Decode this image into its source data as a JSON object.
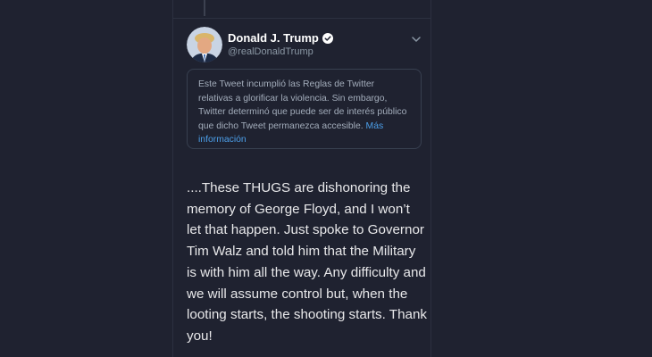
{
  "tweet": {
    "author": {
      "display_name": "Donald J. Trump",
      "handle": "@realDonaldTrump",
      "verified": true
    },
    "icons": {
      "verified": "verified-badge-icon",
      "menu": "chevron-down-icon"
    },
    "notice": {
      "text": "Este Tweet incumplió las Reglas de Twitter relativas a glorificar la violencia. Sin embargo, Twitter determinó que puede ser de interés público que dicho Tweet permanezca accesible.",
      "link_label": "Más información"
    },
    "body_text": "....These THUGS are dishonoring the memory of George Floyd, and I won’t let that happen. Just spoke to Governor Tim Walz and told him that the Military is with him all the way. Any difficulty and we will assume control but, when the looting starts, the shooting starts. Thank you!"
  },
  "colors": {
    "background": "#1f2230",
    "link": "#4c9fe9",
    "verified_badge": "#ffffff",
    "secondary_text": "#8b98a5"
  }
}
